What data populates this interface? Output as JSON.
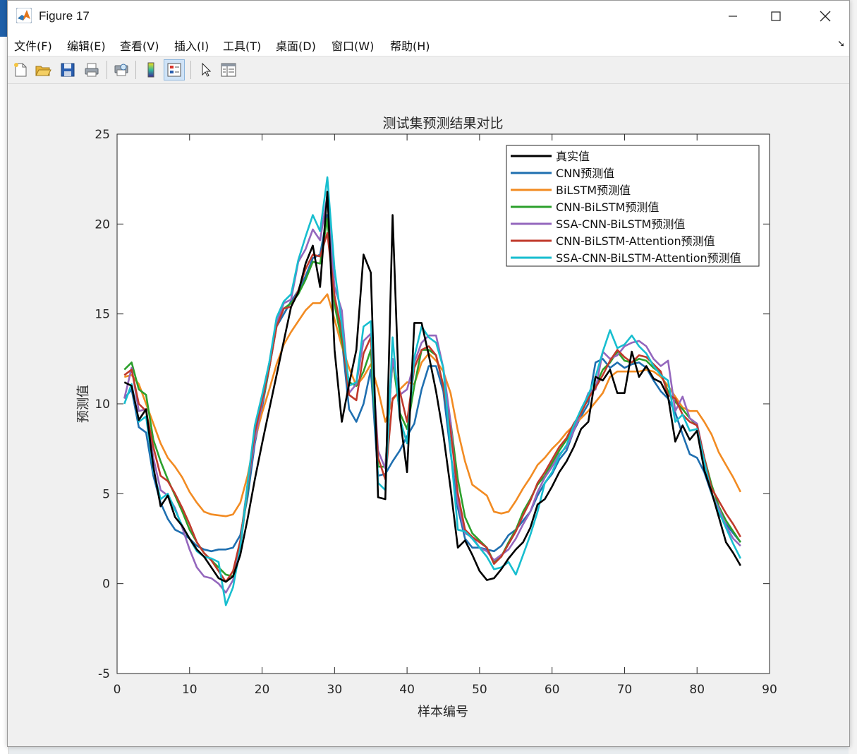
{
  "window": {
    "title": "Figure 17",
    "controls": [
      "minimize",
      "maximize",
      "close"
    ]
  },
  "menu": [
    "文件(F)",
    "编辑(E)",
    "查看(V)",
    "插入(I)",
    "工具(T)",
    "桌面(D)",
    "窗口(W)",
    "帮助(H)"
  ],
  "toolbar": [
    "new-figure-icon",
    "open-file-icon",
    "save-icon",
    "print-icon",
    "print-preview-icon",
    "colorbar-icon",
    "legend-icon",
    "pointer-icon",
    "property-inspector-icon"
  ],
  "chart_data": {
    "type": "line",
    "title": "测试集预测结果对比",
    "xlabel": "样本编号",
    "ylabel": "预测值",
    "xlim": [
      0,
      90
    ],
    "ylim": [
      -5,
      25
    ],
    "xticks": [
      0,
      10,
      20,
      30,
      40,
      50,
      60,
      70,
      80,
      90
    ],
    "yticks": [
      -5,
      0,
      5,
      10,
      15,
      20,
      25
    ],
    "legend_location": "top-right",
    "grid": false,
    "x": [
      1,
      2,
      3,
      4,
      5,
      6,
      7,
      8,
      9,
      10,
      11,
      12,
      13,
      14,
      15,
      16,
      17,
      18,
      19,
      20,
      21,
      22,
      23,
      24,
      25,
      26,
      27,
      28,
      29,
      30,
      31,
      32,
      33,
      34,
      35,
      36,
      37,
      38,
      39,
      40,
      41,
      42,
      43,
      44,
      45,
      46,
      47,
      48,
      49,
      50,
      51,
      52,
      53,
      54,
      55,
      56,
      57,
      58,
      59,
      60,
      61,
      62,
      63,
      64,
      65,
      66,
      67,
      68,
      69,
      70,
      71,
      72,
      73,
      74,
      75,
      76,
      77,
      78,
      79,
      80,
      81,
      82,
      83,
      84,
      85,
      86
    ],
    "series": [
      {
        "name": "真实值",
        "color": "#000000",
        "values": [
          11.2,
          11.0,
          9.1,
          9.7,
          6.5,
          4.3,
          4.9,
          3.7,
          3.2,
          2.5,
          1.9,
          1.5,
          0.9,
          0.3,
          0.1,
          0.4,
          1.6,
          3.6,
          5.8,
          7.8,
          9.7,
          11.6,
          13.5,
          15.4,
          16.2,
          17.8,
          18.8,
          16.5,
          21.8,
          13.0,
          9.0,
          11.1,
          13.0,
          18.3,
          17.3,
          4.8,
          4.7,
          20.5,
          9.3,
          6.2,
          14.5,
          14.5,
          12.7,
          10.7,
          8.3,
          5.3,
          2.0,
          2.4,
          1.6,
          0.7,
          0.2,
          0.3,
          0.8,
          1.4,
          1.9,
          2.3,
          3.1,
          4.4,
          4.7,
          5.4,
          6.2,
          6.8,
          7.6,
          8.6,
          9.0,
          11.5,
          11.3,
          11.9,
          10.6,
          10.6,
          12.9,
          11.5,
          12.1,
          11.4,
          11.2,
          10.4,
          7.9,
          8.8,
          8.0,
          8.5,
          6.3,
          5.1,
          3.7,
          2.3,
          1.7,
          1.0
        ]
      },
      {
        "name": "CNN预测值",
        "color": "#1f6fb0",
        "values": [
          10.3,
          10.8,
          8.7,
          8.4,
          6.0,
          4.5,
          3.6,
          3.0,
          2.8,
          2.5,
          2.1,
          1.9,
          1.8,
          1.9,
          1.9,
          2.0,
          2.7,
          4.8,
          7.8,
          9.8,
          12.0,
          14.3,
          15.0,
          15.7,
          16.3,
          17.1,
          18.1,
          18.3,
          20.5,
          16.0,
          13.6,
          9.7,
          9.0,
          10.0,
          11.9,
          6.0,
          6.1,
          6.8,
          7.4,
          8.2,
          8.9,
          10.8,
          12.1,
          12.1,
          10.7,
          7.3,
          4.2,
          2.5,
          2.0,
          2.0,
          1.9,
          1.8,
          2.1,
          2.7,
          3.0,
          3.5,
          4.0,
          4.9,
          5.6,
          6.1,
          6.9,
          7.4,
          8.5,
          9.3,
          10.0,
          12.3,
          12.5,
          12.0,
          12.3,
          12.0,
          12.2,
          12.3,
          12.0,
          11.3,
          10.7,
          10.3,
          9.5,
          8.3,
          7.2,
          7.0,
          6.2,
          5.0,
          3.9,
          3.3,
          2.8,
          2.3
        ]
      },
      {
        "name": "BiLSTM预测值",
        "color": "#f28b22",
        "values": [
          11.5,
          11.6,
          11.1,
          10.0,
          8.9,
          7.8,
          7.0,
          6.5,
          5.9,
          5.1,
          4.5,
          4.0,
          3.85,
          3.8,
          3.75,
          3.85,
          4.5,
          6.0,
          8.0,
          9.5,
          10.8,
          12.2,
          13.3,
          14.0,
          14.6,
          15.2,
          15.6,
          15.6,
          16.1,
          14.7,
          13.2,
          12.0,
          11.0,
          11.5,
          12.2,
          10.8,
          9.0,
          10.2,
          10.8,
          11.2,
          11.1,
          12.3,
          12.8,
          12.4,
          11.8,
          10.6,
          8.5,
          6.8,
          5.5,
          5.2,
          4.9,
          4.0,
          3.9,
          4.0,
          4.6,
          5.3,
          5.9,
          6.6,
          7.0,
          7.5,
          7.9,
          8.4,
          8.8,
          9.2,
          9.6,
          10.1,
          10.6,
          11.5,
          11.8,
          11.8,
          11.8,
          11.8,
          11.9,
          11.8,
          11.5,
          11.0,
          10.4,
          9.8,
          9.6,
          9.6,
          9.0,
          8.3,
          7.3,
          6.6,
          5.9,
          5.1
        ]
      },
      {
        "name": "CNN-BiLSTM预测值",
        "color": "#2ca02c",
        "values": [
          11.9,
          12.3,
          10.8,
          10.5,
          8.0,
          6.8,
          5.8,
          4.9,
          4.0,
          3.0,
          2.3,
          1.7,
          1.3,
          0.9,
          0.5,
          0.4,
          2.0,
          5.2,
          8.3,
          10.0,
          12.0,
          14.5,
          15.3,
          15.6,
          16.1,
          16.9,
          17.9,
          17.8,
          20.3,
          15.5,
          13.5,
          11.2,
          11.0,
          11.8,
          13.0,
          6.5,
          6.5,
          12.5,
          9.5,
          8.6,
          11.0,
          13.0,
          13.0,
          12.7,
          11.0,
          9.0,
          5.8,
          3.7,
          2.8,
          2.4,
          2.0,
          1.2,
          1.5,
          2.3,
          3.0,
          4.0,
          4.7,
          5.5,
          6.0,
          6.7,
          7.4,
          8.0,
          8.7,
          9.5,
          10.3,
          11.0,
          11.9,
          12.3,
          12.9,
          12.4,
          12.3,
          12.5,
          12.4,
          12.0,
          11.7,
          10.7,
          10.1,
          9.7,
          9.2,
          8.8,
          7.0,
          5.5,
          4.3,
          3.5,
          2.9,
          2.3
        ]
      },
      {
        "name": "SSA-CNN-BiLSTM预测值",
        "color": "#9467bd",
        "values": [
          10.3,
          12.0,
          9.6,
          9.7,
          7.0,
          5.2,
          4.9,
          4.2,
          3.1,
          1.9,
          0.9,
          0.4,
          0.3,
          0.0,
          -0.5,
          0.2,
          2.0,
          5.4,
          8.0,
          10.0,
          12.3,
          14.5,
          15.6,
          15.8,
          17.9,
          18.6,
          19.7,
          19.1,
          21.6,
          16.5,
          15.2,
          10.6,
          11.1,
          13.5,
          13.9,
          7.4,
          6.4,
          12.5,
          10.5,
          10.8,
          12.3,
          13.4,
          13.8,
          13.8,
          12.0,
          9.0,
          4.5,
          2.8,
          2.6,
          2.0,
          1.8,
          1.3,
          1.6,
          1.9,
          2.5,
          3.3,
          4.0,
          5.1,
          5.9,
          6.5,
          7.2,
          7.6,
          8.5,
          9.5,
          10.6,
          10.8,
          12.9,
          12.5,
          12.7,
          13.2,
          13.4,
          13.5,
          13.2,
          12.5,
          12.1,
          12.4,
          9.6,
          10.4,
          9.2,
          8.9,
          7.0,
          5.0,
          4.2,
          3.2,
          2.5,
          2.1
        ]
      },
      {
        "name": "CNN-BiLSTM-Attention预测值",
        "color": "#c0392b",
        "values": [
          11.6,
          11.9,
          10.0,
          9.6,
          7.6,
          6.0,
          5.7,
          5.0,
          4.2,
          3.3,
          2.3,
          1.7,
          1.3,
          0.7,
          0.1,
          0.7,
          2.4,
          5.5,
          8.4,
          10.2,
          12.0,
          14.3,
          15.3,
          15.4,
          16.3,
          17.5,
          18.3,
          18.2,
          19.5,
          16.0,
          14.0,
          10.5,
          10.2,
          12.8,
          13.7,
          7.0,
          5.8,
          10.3,
          10.7,
          9.0,
          12.0,
          13.0,
          13.2,
          12.7,
          11.0,
          8.5,
          5.0,
          3.0,
          2.6,
          2.3,
          2.0,
          1.1,
          1.5,
          2.2,
          2.9,
          3.8,
          4.6,
          5.6,
          6.2,
          6.9,
          7.6,
          8.1,
          8.9,
          9.5,
          10.3,
          10.9,
          11.6,
          12.4,
          13.0,
          12.6,
          12.3,
          12.7,
          12.6,
          12.2,
          11.8,
          10.5,
          10.3,
          9.4,
          9.0,
          8.8,
          7.0,
          5.3,
          4.6,
          3.9,
          3.3,
          2.6
        ]
      },
      {
        "name": "SSA-CNN-BiLSTM-Attention预测值",
        "color": "#17becf",
        "values": [
          10.0,
          11.1,
          9.0,
          9.3,
          6.3,
          4.7,
          5.0,
          4.1,
          3.2,
          2.5,
          1.8,
          1.5,
          1.4,
          1.2,
          -1.2,
          -0.2,
          2.0,
          5.6,
          8.8,
          10.5,
          12.3,
          14.8,
          15.7,
          16.1,
          18.0,
          19.3,
          20.5,
          19.6,
          22.6,
          17.5,
          14.4,
          11.0,
          11.2,
          14.3,
          14.6,
          5.6,
          5.2,
          13.7,
          9.2,
          7.8,
          12.6,
          14.3,
          13.7,
          13.4,
          12.0,
          7.5,
          3.0,
          2.9,
          2.5,
          2.0,
          1.5,
          0.8,
          0.9,
          1.2,
          0.5,
          1.6,
          2.7,
          4.0,
          5.6,
          6.2,
          7.1,
          7.7,
          8.8,
          9.7,
          10.5,
          11.5,
          12.9,
          14.1,
          13.1,
          13.3,
          13.8,
          13.2,
          12.8,
          12.1,
          11.6,
          11.3,
          9.0,
          9.4,
          8.5,
          8.6,
          6.8,
          5.0,
          4.0,
          3.1,
          2.2,
          1.4
        ]
      }
    ]
  }
}
